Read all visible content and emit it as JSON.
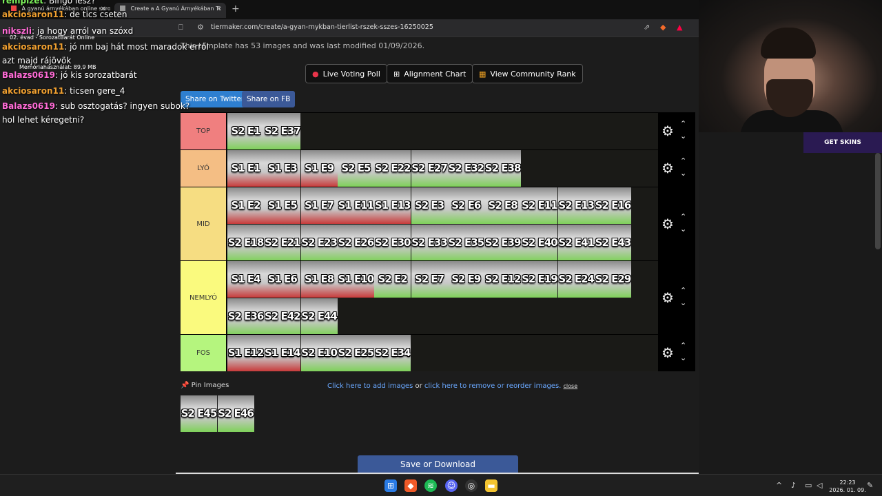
{
  "browser": {
    "tabs": [
      {
        "label": "A gyanú árnyékában online sorozat"
      },
      {
        "label": "Create a A Gyanú Árnyékában Ti"
      }
    ],
    "new_tab": "+",
    "url": "tiermaker.com/create/a-gyan-rnykban-tierlist-rszek-sszes-16250025"
  },
  "page": {
    "notice": "This template has 53 images and was last modified 01/09/2026.",
    "buttons": {
      "live_voting": "Live Voting Poll",
      "alignment": "Alignment Chart",
      "community": "View Community Rank"
    },
    "share": {
      "twitter": "Share on Twitter",
      "fb": "Share on FB"
    },
    "tiers": [
      {
        "label": "TOP",
        "color": "#f07f7f",
        "rows": [
          [
            "S2 E1",
            "S2 E37"
          ]
        ]
      },
      {
        "label": "LYÓ",
        "color": "#f4be84",
        "rows": [
          [
            "S1 E1",
            "S1 E3",
            "S1 E9",
            "S2 E5",
            "S2 E22",
            "S2 E27",
            "S2 E32",
            "S2 E38"
          ]
        ]
      },
      {
        "label": "MID",
        "color": "#f6dd82",
        "rows": [
          [
            "S1 E2",
            "S1 E5",
            "S1 E7",
            "S1 E11",
            "S1 E13",
            "S2 E3",
            "S2 E6",
            "S2 E8",
            "S2 E11",
            "S2 E13",
            "S2 E16"
          ],
          [
            "S2 E18",
            "S2 E21",
            "S2 E23",
            "S2 E26",
            "S2 E30",
            "S2 E33",
            "S2 E35",
            "S2 E39",
            "S2 E40",
            "S2 E41",
            "S2 E43"
          ]
        ]
      },
      {
        "label": "NEMLYÓ",
        "color": "#fafa7e",
        "rows": [
          [
            "S1 E4",
            "S1 E6",
            "S1 E8",
            "S1 E10",
            "S2 E2",
            "S2 E7",
            "S2 E9",
            "S2 E12",
            "S2 E19",
            "S2 E24",
            "S2 E29"
          ],
          [
            "S2 E36",
            "S2 E42",
            "S2 E44"
          ]
        ]
      },
      {
        "label": "FOS",
        "color": "#b5f57e",
        "rows": [
          [
            "S1 E12",
            "S1 E14",
            "S2 E10",
            "S2 E25",
            "S2 E34"
          ]
        ]
      }
    ],
    "pin_images": "Pin Images",
    "unplaced": [
      "S2 E45",
      "S2 E46"
    ],
    "links": {
      "add": "Click here to add images",
      "or": "or",
      "remove": "click here to remove or reorder images.",
      "close": "close"
    },
    "save": "Save or Download"
  },
  "chat": [
    {
      "user": "rempizet",
      "text": "Bingo lesz?",
      "color": "#7cf05a"
    },
    {
      "user": "akciosaron11",
      "text": "de tics cseten",
      "color": "#f0a030"
    },
    {
      "user": "nikszli",
      "text": "ja hogy arról van szóxd",
      "color": "#ff6bd6"
    },
    {
      "user": "akciosaron11",
      "text": "jó nm baj hát most maradok erről",
      "color": "#f0a030"
    },
    {
      "user": "",
      "text": "azt majd rájövök",
      "color": "#fff"
    },
    {
      "user": "Balazs0619",
      "text": "jó kis sorozatbarát",
      "color": "#ff6bd6"
    },
    {
      "user": "akciosaron11",
      "text": "ticsen gere_4",
      "color": "#f0a030"
    },
    {
      "user": "Balazs0619",
      "text": "sub osztogatás? ingyen subok?",
      "color": "#ff6bd6"
    },
    {
      "user": "",
      "text": "hol lehet kéregetni?",
      "color": "#fff"
    }
  ],
  "overlay": {
    "line1": "02. évad - SorozatBarát Online",
    "line2": "Memóriahasználat: 89,9 MB"
  },
  "stream": {
    "skins": "GET SKINS"
  },
  "taskbar": {
    "time": "22:23",
    "date": "2026. 01. 09."
  }
}
